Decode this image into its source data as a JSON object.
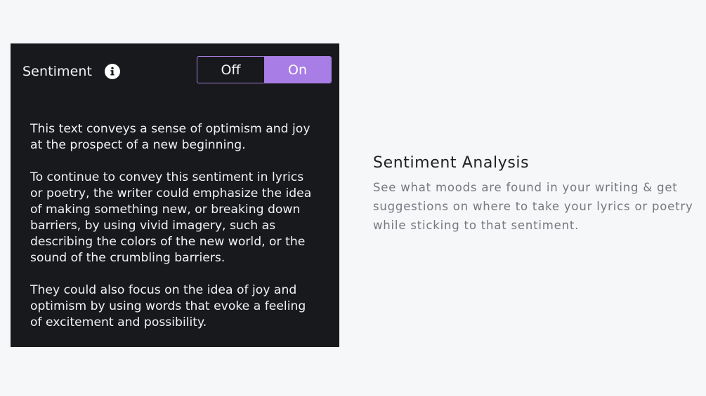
{
  "panel": {
    "title": "Sentiment",
    "info_icon": "info-circle-icon",
    "toggle": {
      "options": [
        "Off",
        "On"
      ],
      "selected": "On",
      "accent_color": "#a87de6"
    },
    "body_paragraphs": [
      "This text conveys a sense of optimism and joy at the prospect of a new beginning.",
      "To continue to convey this sentiment in lyrics or poetry, the writer could emphasize the idea of making something new, or breaking down barriers, by using vivid imagery, such as describing the colors of the new world, or the sound of the crumbling barriers.",
      "They could also focus on the idea of joy and optimism by using words that evoke a feeling of excitement and possibility."
    ]
  },
  "feature": {
    "title": "Sentiment Analysis",
    "description": "See what moods are found in your writing & get suggestions on where to take your lyrics or poetry while sticking to that sentiment."
  },
  "colors": {
    "page_background": "#f6f7f9",
    "panel_background": "#18191d",
    "accent": "#a87de6"
  }
}
